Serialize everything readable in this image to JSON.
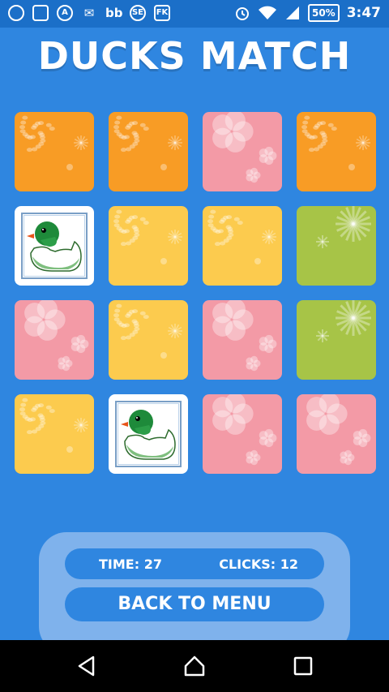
{
  "status_bar": {
    "battery": "50%",
    "time": "3:47",
    "icons": [
      "sync-icon",
      "image-icon",
      "a-app-icon",
      "gmail-icon",
      "bb-icon",
      "se-icon",
      "fk-icon",
      "alarm-icon",
      "wifi-icon",
      "signal-icon"
    ]
  },
  "game": {
    "title": "DUCKS MATCH",
    "time_label": "TIME: 27",
    "clicks_label": "CLICKS: 12",
    "menu_button": "BACK TO MENU"
  },
  "board": {
    "rows": 4,
    "cols": 4,
    "cards": [
      [
        "orange",
        "orange",
        "pink",
        "orange"
      ],
      [
        "duck",
        "yellow",
        "yellow",
        "green"
      ],
      [
        "pink",
        "yellow",
        "pink",
        "green"
      ],
      [
        "yellow",
        "duck",
        "pink",
        "pink"
      ]
    ],
    "colors": {
      "orange": "#f89c25",
      "yellow": "#fccb4e",
      "pink": "#f39aa6",
      "green": "#a7c447"
    }
  },
  "navigation": {
    "buttons": [
      "back-icon",
      "home-icon",
      "recents-icon"
    ]
  }
}
